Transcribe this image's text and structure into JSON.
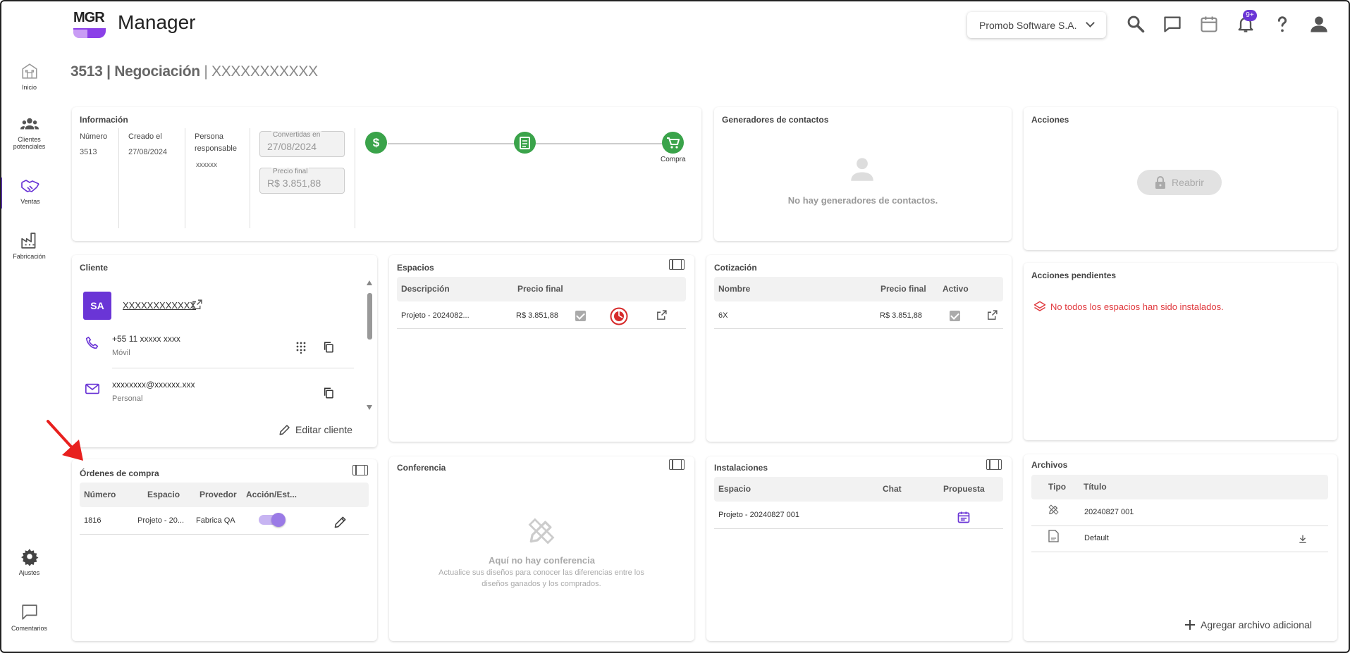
{
  "app": {
    "logo_text": "MGR",
    "title": "Manager",
    "company": "Promob Software S.A.",
    "notif_badge": "9+"
  },
  "sidebar": {
    "items": [
      {
        "label": "Inicio",
        "icon": "home-icon"
      },
      {
        "label": "Clientes potenciales",
        "icon": "people-icon"
      },
      {
        "label": "Ventas",
        "icon": "handshake-icon"
      },
      {
        "label": "Fabricación",
        "icon": "factory-icon"
      },
      {
        "label": "Ajustes",
        "icon": "gear-icon"
      },
      {
        "label": "Comentarios",
        "icon": "comment-icon"
      }
    ]
  },
  "header": {
    "number": "3513",
    "separator": "|",
    "status": "Negociación",
    "client": "XXXXXXXXXXX"
  },
  "info": {
    "title": "Información",
    "numero_label": "Número",
    "numero": "3513",
    "creado_label": "Creado el",
    "creado": "27/08/2024",
    "persona_label": "Persona responsable",
    "persona": "xxxxxx",
    "convertidas_label": "Convertidas en",
    "convertidas": "27/08/2024",
    "precio_label": "Precio final",
    "precio": "R$ 3.851,88",
    "stepper_last_label": "Compra"
  },
  "generadores": {
    "title": "Generadores de contactos",
    "empty": "No hay generadores de contactos."
  },
  "acciones": {
    "title": "Acciones",
    "reabrir": "Reabrir"
  },
  "cliente": {
    "title": "Cliente",
    "avatar": "SA",
    "name": "XXXXXXXXXXXX",
    "phone": "+55 11 xxxxx xxxx",
    "phone_type": "Móvil",
    "email": "xxxxxxxx@xxxxxx.xxx",
    "email_type": "Personal",
    "edit": "Editar cliente"
  },
  "espacios": {
    "title": "Espacios",
    "headers": [
      "Descripción",
      "Precio final"
    ],
    "rows": [
      {
        "desc": "Projeto - 2024082...",
        "precio": "R$ 3.851,88"
      }
    ]
  },
  "cotizacion": {
    "title": "Cotización",
    "headers": [
      "Nombre",
      "Precio final",
      "Activo"
    ],
    "rows": [
      {
        "nombre": "6X",
        "precio": "R$ 3.851,88"
      }
    ]
  },
  "pendientes": {
    "title": "Acciones pendientes",
    "warning": "No todos los espacios han sido instalados."
  },
  "ordenes": {
    "title": "Órdenes de compra",
    "headers": [
      "Número",
      "Espacio",
      "Provedor",
      "Acción/Est..."
    ],
    "rows": [
      {
        "numero": "1816",
        "espacio": "Projeto - 20...",
        "proveedor": "Fabrica QA"
      }
    ]
  },
  "conferencia": {
    "title": "Conferencia",
    "empty_title": "Aquí no hay conferencia",
    "empty_desc": "Actualice sus diseños para conocer las diferencias entre los diseños ganados y los comprados."
  },
  "instalaciones": {
    "title": "Instalaciones",
    "headers": [
      "Espacio",
      "Chat",
      "Propuesta"
    ],
    "rows": [
      {
        "espacio": "Projeto - 20240827 001"
      }
    ]
  },
  "archivos": {
    "title": "Archivos",
    "headers": [
      "Tipo",
      "Título"
    ],
    "rows": [
      {
        "titulo": "20240827 001"
      },
      {
        "titulo": "Default"
      }
    ],
    "add": "Agregar archivo adicional"
  },
  "colors": {
    "accent": "#6a35d6",
    "success": "#3aa34a",
    "warning": "#e0393e"
  }
}
